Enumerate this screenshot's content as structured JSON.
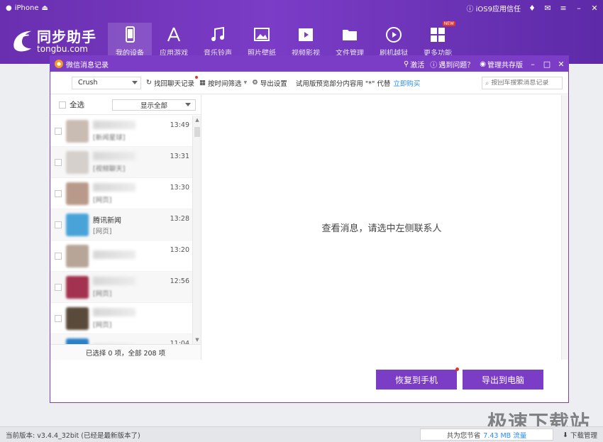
{
  "titlebar": {
    "device": "iPhone",
    "ios9_trust": "iOS9应用信任"
  },
  "logo": {
    "name": "同步助手",
    "sub": "tongbu.com"
  },
  "nav": [
    {
      "id": "device",
      "label": "我的设备",
      "icon": "phone-icon"
    },
    {
      "id": "apps",
      "label": "应用游戏",
      "icon": "app-store-icon"
    },
    {
      "id": "music",
      "label": "音乐铃声",
      "icon": "music-icon"
    },
    {
      "id": "photos",
      "label": "照片壁纸",
      "icon": "picture-icon"
    },
    {
      "id": "video",
      "label": "视频影视",
      "icon": "film-icon"
    },
    {
      "id": "files",
      "label": "文件管理",
      "icon": "folder-icon"
    },
    {
      "id": "flash",
      "label": "刷机越狱",
      "icon": "play-circle-icon"
    },
    {
      "id": "more",
      "label": "更多功能",
      "icon": "grid-icon",
      "badge": "NEW"
    }
  ],
  "dialog": {
    "title": "微信消息记录",
    "activate": "激活",
    "help": "遇到问题？",
    "shared": "管理共存版"
  },
  "toolbar": {
    "contact": "Crush",
    "recover_chat": "找回聊天记录",
    "time_filter": "按时间筛选",
    "export_settings": "导出设置",
    "trial_text": "试用版预览部分内容用 \"*\" 代替",
    "buy": "立即购买",
    "search_placeholder": "按回车搜索消息记录"
  },
  "list": {
    "select_all": "全选",
    "filter": "显示全部",
    "contacts": [
      {
        "name": "",
        "msg": "[新闻星球]",
        "time": "13:49",
        "color": "#c9bcb3",
        "blur": true
      },
      {
        "name": "",
        "msg": "[视频聊天]",
        "time": "13:31",
        "color": "#d6d0cc",
        "blur": true
      },
      {
        "name": "",
        "msg": "[网页]",
        "time": "13:30",
        "color": "#b99a8a",
        "blur": true
      },
      {
        "name": "腾讯新闻",
        "msg": "[网页]",
        "time": "13:28",
        "color": "#4aa3d8",
        "blur": false
      },
      {
        "name": "",
        "msg": "",
        "time": "13:20",
        "color": "#b7a597",
        "blur": true
      },
      {
        "name": "",
        "msg": "[网页]",
        "time": "12:56",
        "color": "#a2324f",
        "blur": true
      },
      {
        "name": "",
        "msg": "[网页]",
        "time": "",
        "color": "#5a4a3a",
        "blur": true
      },
      {
        "name": "",
        "msg": "",
        "time": "11:04",
        "color": "#2a80c8",
        "blur": true
      }
    ],
    "summary": "已选择 0 项，全部 208 项"
  },
  "main": {
    "hint": "查看消息，请选中左侧联系人"
  },
  "buttons": {
    "restore": "恢复到手机",
    "export": "导出到电脑"
  },
  "status": {
    "version": "当前版本: v3.4.4_32bit  (已经是最新版本了)",
    "saved_prefix": "共为您节省",
    "saved_value": "7.43 MB 流量",
    "download_mgr": "下载管理"
  },
  "watermark": "极速下载站",
  "colors": {
    "brand": "#7b3cc6",
    "accent_link": "#2a8de8",
    "badge": "#e5352b"
  }
}
